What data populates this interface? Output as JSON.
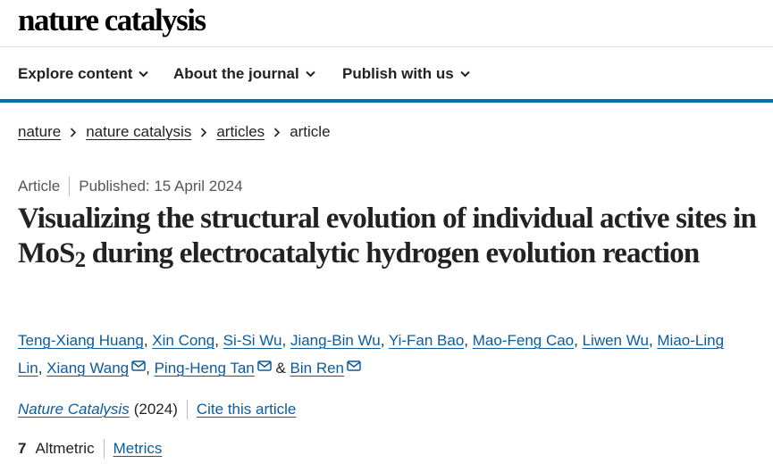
{
  "site": {
    "logo": "nature catalysis"
  },
  "nav": {
    "items": [
      {
        "label": "Explore content"
      },
      {
        "label": "About the journal"
      },
      {
        "label": "Publish with us"
      }
    ]
  },
  "breadcrumb": [
    "nature",
    "nature catalysis",
    "articles",
    "article"
  ],
  "article": {
    "type": "Article",
    "published": "Published: 15 April 2024",
    "title_part1": "Visualizing the structural evolution of individual active sites in MoS",
    "title_sub": "2",
    "title_part2": " during electrocatalytic hydrogen evolution reaction",
    "authors": [
      "Teng-Xiang Huang",
      "Xin Cong",
      "Si-Si Wu",
      "Jiang-Bin Wu",
      "Yi-Fan Bao",
      "Mao-Feng Cao",
      "Liwen Wu",
      "Miao-Ling Lin",
      "Xiang Wang",
      "Ping-Heng Tan",
      "Bin Ren"
    ],
    "separators": {
      "comma": ", ",
      "amp": " & "
    },
    "journal": "Nature Catalysis",
    "year": "(2024)",
    "cite_label": "Cite this article"
  },
  "metrics": {
    "altmetric_value": "7",
    "altmetric_label": "Altmetric",
    "metrics_link": "Metrics"
  },
  "colors": {
    "link": "#0b5c9e",
    "nav_rule": "#0070a8",
    "text": "#222222",
    "meta": "#555555"
  },
  "icons": {
    "dropdown": "chevron-down-icon",
    "breadcrumb_separator": "chevron-right-icon",
    "email": "envelope-icon"
  }
}
